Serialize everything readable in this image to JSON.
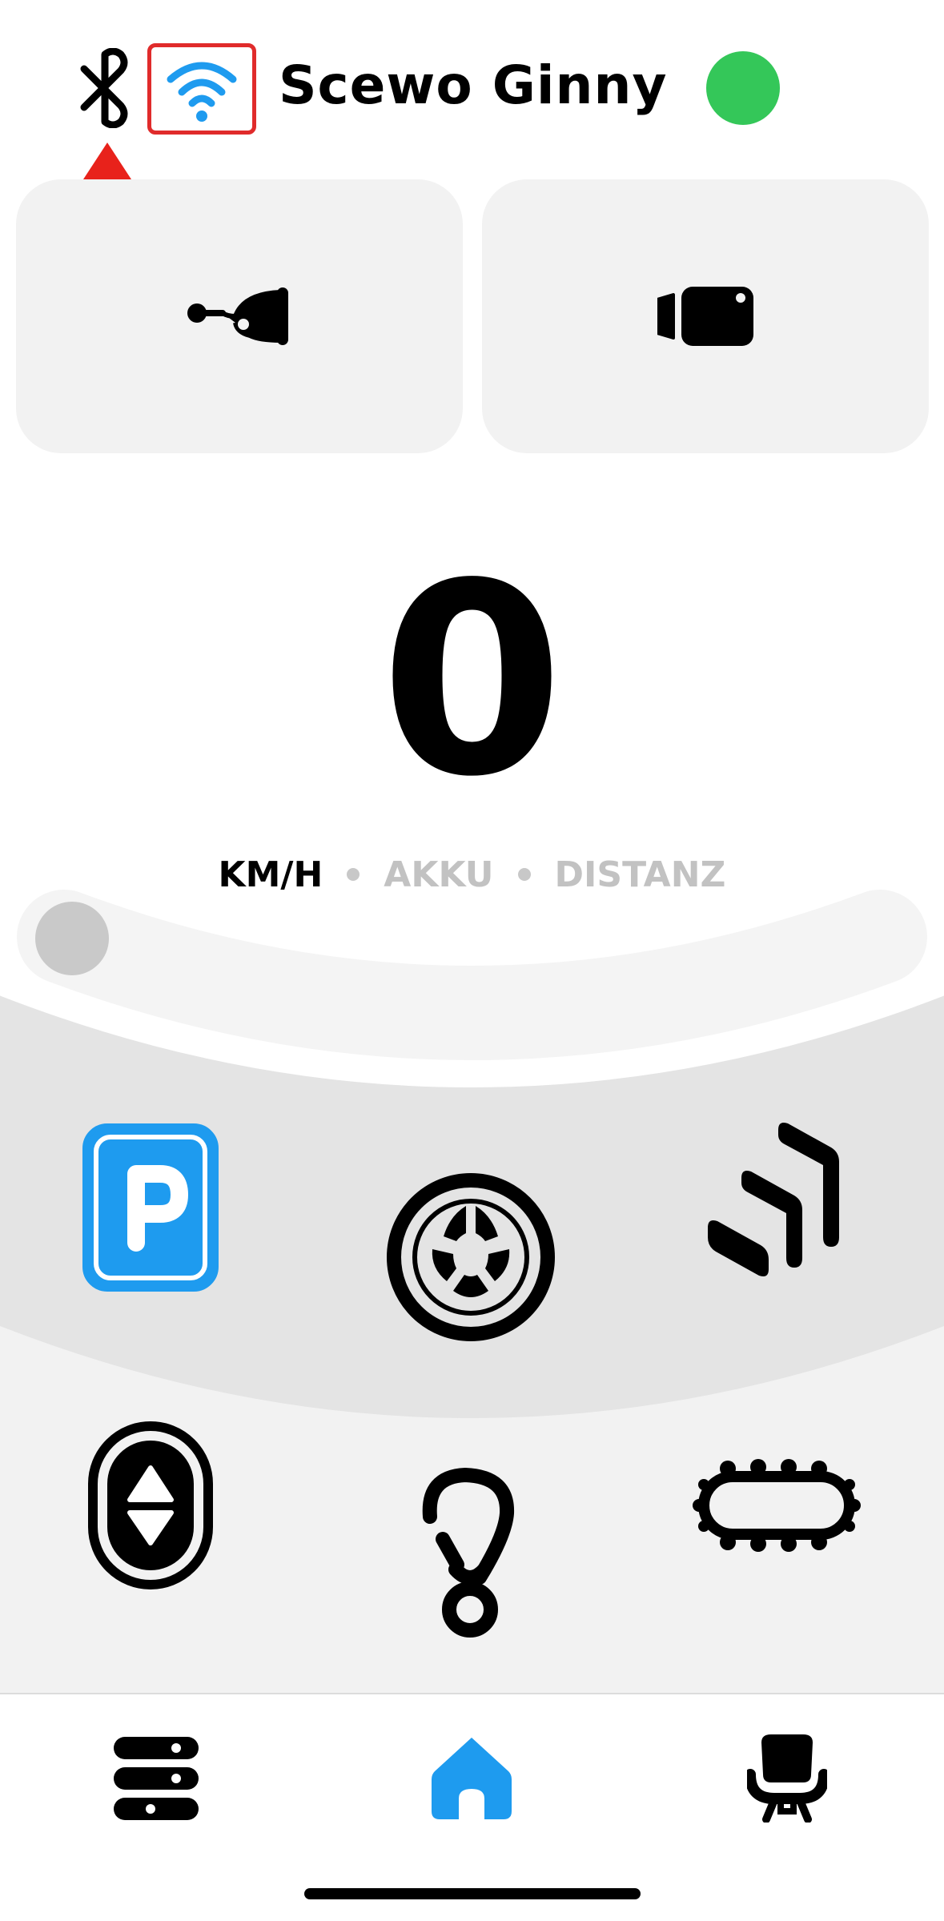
{
  "header": {
    "device_name": "Scewo Ginny",
    "bluetooth_icon": "bluetooth-icon",
    "wifi_icon": "wifi-icon",
    "connection_status_color": "#34c759",
    "highlight_color": "#e02b2b"
  },
  "actions": {
    "horn": {
      "icon": "horn-icon"
    },
    "camera": {
      "icon": "camera-icon"
    }
  },
  "speed": {
    "value": "0"
  },
  "metrics": {
    "items": [
      {
        "label": "KM/H",
        "active": true
      },
      {
        "label": "AKKU",
        "active": false
      },
      {
        "label": "DISTANZ",
        "active": false
      }
    ]
  },
  "modes": [
    {
      "id": "parking",
      "icon": "parking-icon",
      "active": true,
      "accent": "#1e9bef"
    },
    {
      "id": "drive",
      "icon": "wheel-icon",
      "active": false
    },
    {
      "id": "stairs",
      "icon": "stairs-icon",
      "active": false
    },
    {
      "id": "height",
      "icon": "height-adjust-icon",
      "active": false
    },
    {
      "id": "hook",
      "icon": "hook-icon",
      "active": false
    },
    {
      "id": "tracks",
      "icon": "track-icon",
      "active": false
    }
  ],
  "tabbar": {
    "tabs": [
      {
        "id": "menu",
        "icon": "server-menu-icon",
        "active": false
      },
      {
        "id": "home",
        "icon": "home-icon",
        "active": true,
        "accent": "#1e9bef"
      },
      {
        "id": "seat",
        "icon": "seat-icon",
        "active": false
      }
    ]
  }
}
